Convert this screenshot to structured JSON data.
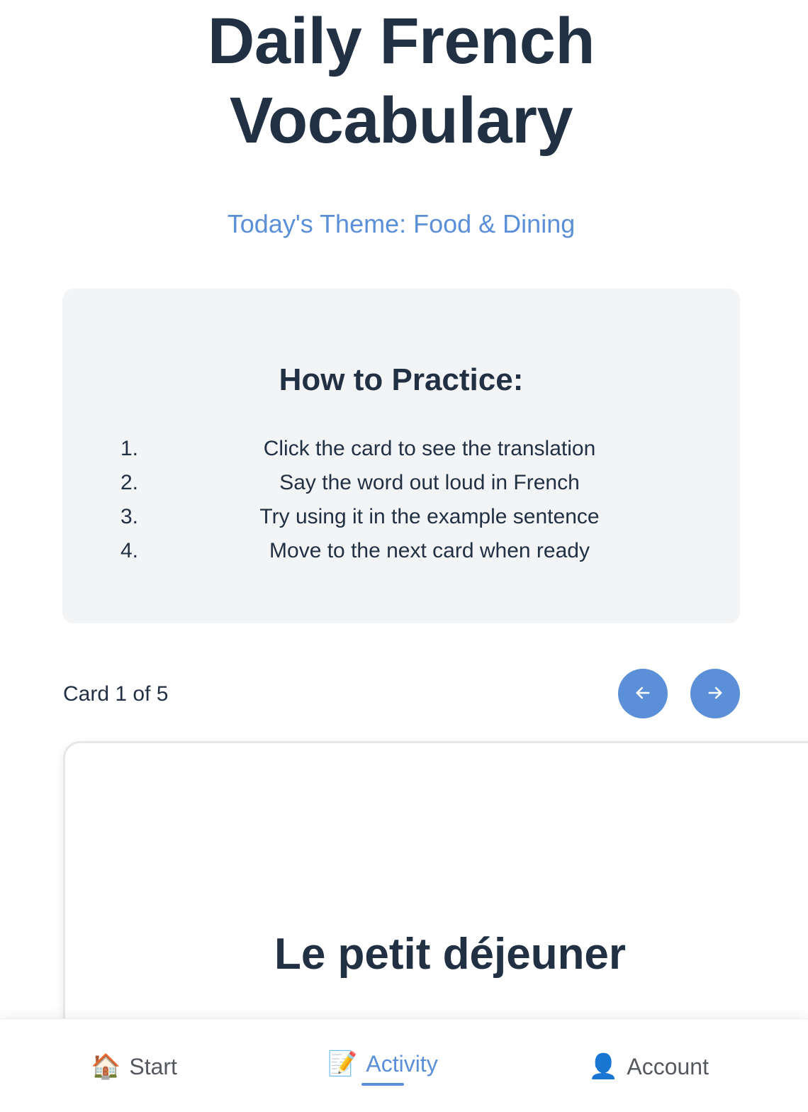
{
  "header": {
    "title_line1": "Daily French",
    "title_line2": "Vocabulary",
    "theme": "Today's Theme: Food & Dining"
  },
  "practice": {
    "title": "How to Practice:",
    "steps": [
      {
        "num": "1.",
        "text": "Click the card to see the translation"
      },
      {
        "num": "2.",
        "text": "Say the word out loud in French"
      },
      {
        "num": "3.",
        "text": "Try using it in the example sentence"
      },
      {
        "num": "4.",
        "text": "Move to the next card when ready"
      }
    ]
  },
  "cards": {
    "counter": "Card 1 of 5",
    "current_word": "Le petit déjeuner",
    "prev_icon": "arrow-left-icon",
    "next_icon": "arrow-right-icon"
  },
  "bottom_nav": {
    "items": [
      {
        "label": "Start",
        "icon": "🏠",
        "active": false
      },
      {
        "label": "Activity",
        "icon": "📝",
        "active": true
      },
      {
        "label": "Account",
        "icon": "👤",
        "active": false
      }
    ]
  },
  "colors": {
    "accent": "#5b8fd8",
    "text_dark": "#223044",
    "panel_bg": "#f3f4f5"
  }
}
